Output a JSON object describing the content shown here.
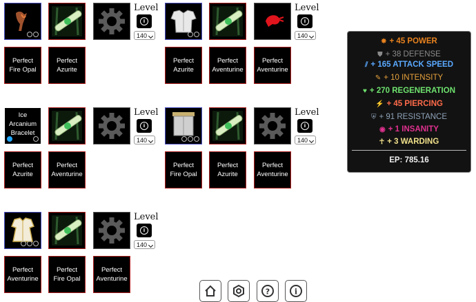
{
  "level_label": "Level",
  "info_symbol": "i",
  "builds": [
    {
      "item": {
        "icon": "flame-weapon-icon",
        "text": "",
        "sockets": [
          "empty",
          "empty"
        ]
      },
      "scroll_icon": "scroll-icon",
      "gear_icon": "gear-icon",
      "level": "140",
      "gems": [
        "Perfect Fire Opal",
        "Perfect Azurite"
      ]
    },
    {
      "item": {
        "icon": "chest-armor-icon",
        "text": "",
        "sockets": [
          "empty",
          "empty"
        ]
      },
      "scroll_icon": "scroll-icon",
      "third_icon": "red-shrimp-icon",
      "level": "140",
      "gems": [
        "Perfect Azurite",
        "Perfect Aventurine",
        "Perfect Aventurine"
      ]
    },
    {
      "item": {
        "icon": "bracelet-icon",
        "text": "Ice Arcanium Bracelet",
        "sockets": [
          "filled",
          "empty"
        ]
      },
      "scroll_icon": "scroll-icon",
      "gear_icon": "gear-icon",
      "level": "140",
      "gems": [
        "Perfect Azurite",
        "Perfect Aventurine"
      ]
    },
    {
      "item": {
        "icon": "leg-armor-icon",
        "text": "",
        "sockets": [
          "empty",
          "empty",
          "empty"
        ]
      },
      "scroll_icon": "scroll-icon",
      "gear_icon": "gear-icon",
      "level": "140",
      "gems": [
        "Perfect Fire Opal",
        "Perfect Azurite",
        "Perfect Aventurine"
      ]
    },
    {
      "item": {
        "icon": "robe-armor-icon",
        "text": "",
        "sockets": [
          "empty",
          "empty",
          "empty"
        ]
      },
      "scroll_icon": "scroll-icon",
      "gear_icon": "gear-icon",
      "level": "140",
      "gems": [
        "Perfect Aventurine",
        "Perfect Fire Opal",
        "Perfect Aventurine"
      ]
    }
  ],
  "stats": [
    {
      "icon": "power-icon",
      "text": "+ 45 POWER",
      "color": "#e8821e"
    },
    {
      "icon": "shield-icon",
      "text": "+ 38 DEFENSE",
      "color": "#8a8a8a"
    },
    {
      "icon": "attack-speed-icon",
      "text": "+ 165 ATTACK SPEED",
      "color": "#5aa9ff"
    },
    {
      "icon": "intensity-icon",
      "text": "+ 10 INTENSITY",
      "color": "#e6a23c"
    },
    {
      "icon": "regeneration-icon",
      "text": "+ 270 REGENERATION",
      "color": "#6ee36e"
    },
    {
      "icon": "piercing-icon",
      "text": "+ 45 PIERCING",
      "color": "#ff6b4a"
    },
    {
      "icon": "resistance-icon",
      "text": "+ 91 RESISTANCE",
      "color": "#8fa3b8"
    },
    {
      "icon": "insanity-icon",
      "text": "+ 1 INSANITY",
      "color": "#e0318f"
    },
    {
      "icon": "warding-icon",
      "text": "+ 3 WARDING",
      "color": "#f0e08a"
    }
  ],
  "ep_text": "EP: 785.16",
  "nav": [
    {
      "name": "home-icon"
    },
    {
      "name": "settings-hex-icon"
    },
    {
      "name": "help-icon",
      "symbol": "?"
    },
    {
      "name": "info-icon",
      "symbol": "i"
    }
  ]
}
